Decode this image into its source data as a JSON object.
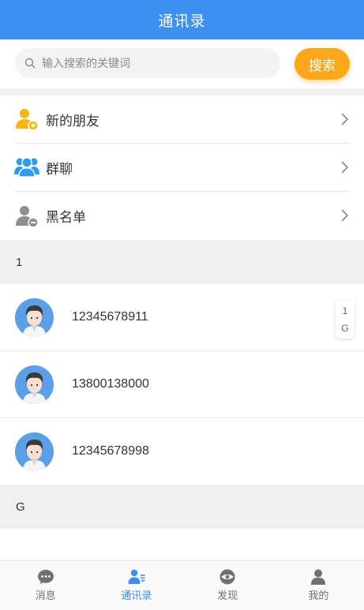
{
  "header": {
    "title": "通讯录"
  },
  "search": {
    "placeholder": "输入搜索的关键词",
    "value": "",
    "button_label": "搜索"
  },
  "menu": [
    {
      "label": "新的朋友",
      "icon": "add-friend-icon",
      "color": "#f9b50f"
    },
    {
      "label": "群聊",
      "icon": "group-chat-icon",
      "color": "#2f9cf0"
    },
    {
      "label": "黑名单",
      "icon": "blacklist-icon",
      "color": "#8f8f8f"
    }
  ],
  "sections": [
    {
      "letter": "1",
      "contacts": [
        "12345678911",
        "13800138000",
        "12345678998"
      ]
    },
    {
      "letter": "G",
      "contacts": []
    }
  ],
  "index_bar": [
    "1",
    "G"
  ],
  "tabbar": [
    {
      "label": "消息",
      "icon": "message-icon",
      "active": false
    },
    {
      "label": "通讯录",
      "icon": "contacts-icon",
      "active": true
    },
    {
      "label": "发现",
      "icon": "discover-eye-icon",
      "active": false
    },
    {
      "label": "我的",
      "icon": "profile-icon",
      "active": false
    }
  ],
  "colors": {
    "header": "#3d8ff0",
    "search_button": "#fba71a",
    "active_tab": "#3d8ff0",
    "inactive_tab": "#707070"
  }
}
